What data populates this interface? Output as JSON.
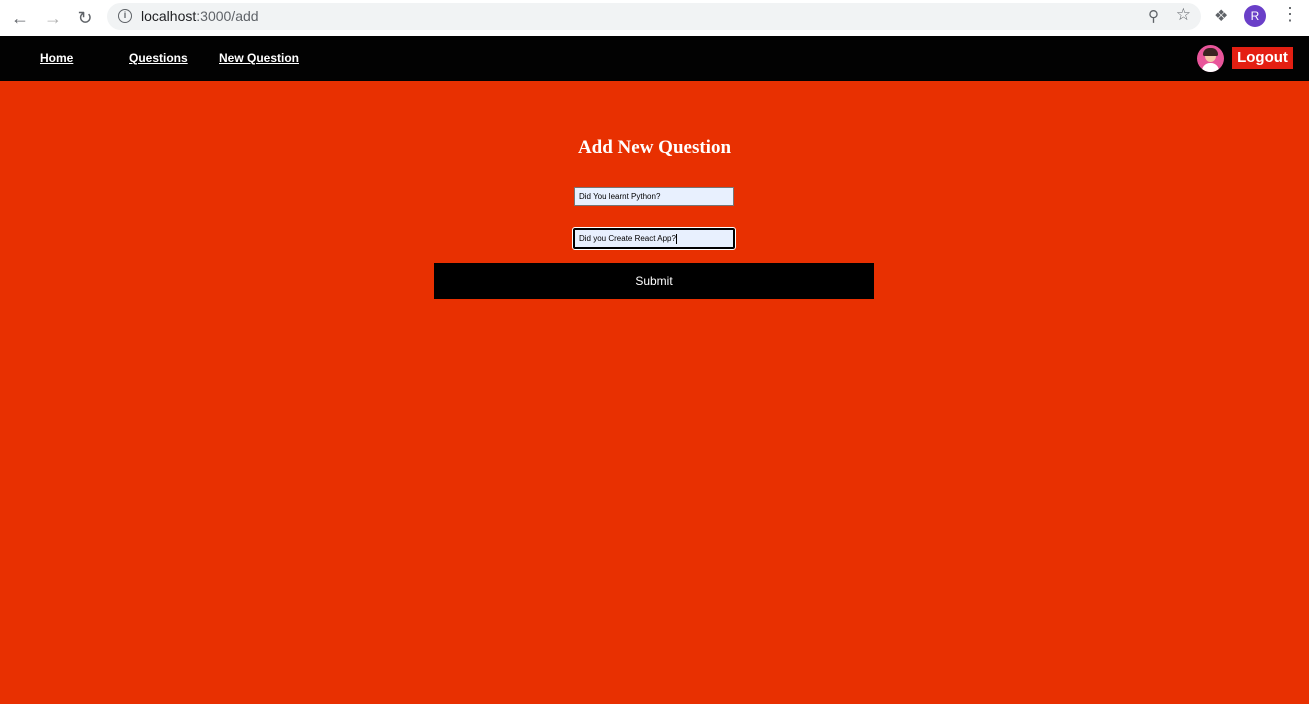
{
  "browser": {
    "url_host": "localhost",
    "url_path": ":3000/add",
    "profile_initial": "R",
    "icons": {
      "back": "back-arrow-icon",
      "forward": "forward-arrow-icon",
      "reload": "reload-icon",
      "info": "info-icon",
      "zoom": "zoom-icon",
      "bookmark": "star-icon",
      "extensions": "puzzle-icon",
      "menu": "kebab-menu-icon"
    }
  },
  "nav": {
    "home": "Home",
    "questions": "Questions",
    "new_question": "New Question",
    "logout": "Logout"
  },
  "form": {
    "title": "Add New Question",
    "option_one": "Did You learnt Python?",
    "option_two": "Did you Create React App?",
    "submit": "Submit"
  },
  "colors": {
    "nav_bg": "#020202",
    "page_bg": "#e83001",
    "logout_bg": "#e41f12",
    "submit_bg": "#000000"
  }
}
